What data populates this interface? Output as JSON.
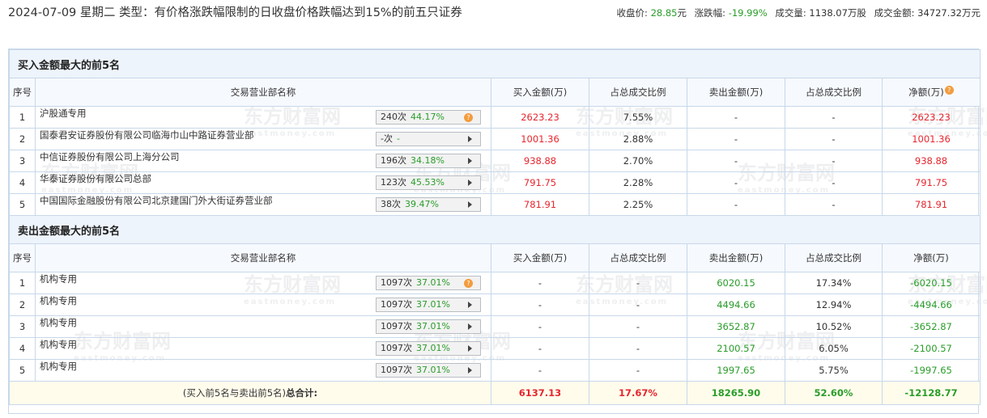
{
  "header": {
    "title": "2024-07-09 星期二 类型：有价格涨跌幅限制的日收盘价格跌幅达到15%的前五只证券",
    "close_label": "收盘价:",
    "close_value": "28.85",
    "close_unit": "元",
    "change_label": "涨跌幅:",
    "change_value": "-19.99%",
    "volume_label": "成交量:",
    "volume_value": "1138.07万股",
    "amount_label": "成交金额:",
    "amount_value": "34727.32万元"
  },
  "columns": {
    "seq": "序号",
    "dept": "交易营业部名称",
    "buy": "买入金额(万)",
    "buy_ratio": "占总成交比例",
    "sell": "卖出金额(万)",
    "sell_ratio": "占总成交比例",
    "net": "净额(万)"
  },
  "buy_section": {
    "title": "买入金额最大的前5名",
    "rows": [
      {
        "seq": "1",
        "name": "沪股通专用",
        "count": "240次",
        "pct": "44.17%",
        "buy": "2623.23",
        "buy_ratio": "7.55%",
        "sell": "-",
        "sell_ratio": "-",
        "net": "2623.23",
        "icon": "question-icon"
      },
      {
        "seq": "2",
        "name": "国泰君安证券股份有限公司临海巾山中路证券营业部",
        "count": "-次",
        "pct": "-",
        "buy": "1001.36",
        "buy_ratio": "2.88%",
        "sell": "-",
        "sell_ratio": "-",
        "net": "1001.36",
        "icon": "arrow-right-icon"
      },
      {
        "seq": "3",
        "name": "中信证券股份有限公司上海分公司",
        "count": "196次",
        "pct": "34.18%",
        "buy": "938.88",
        "buy_ratio": "2.70%",
        "sell": "-",
        "sell_ratio": "-",
        "net": "938.88",
        "icon": "arrow-right-icon"
      },
      {
        "seq": "4",
        "name": "华泰证券股份有限公司总部",
        "count": "123次",
        "pct": "45.53%",
        "buy": "791.75",
        "buy_ratio": "2.28%",
        "sell": "-",
        "sell_ratio": "-",
        "net": "791.75",
        "icon": "arrow-right-icon"
      },
      {
        "seq": "5",
        "name": "中国国际金融股份有限公司北京建国门外大街证券营业部",
        "count": "38次",
        "pct": "39.47%",
        "buy": "781.91",
        "buy_ratio": "2.25%",
        "sell": "-",
        "sell_ratio": "-",
        "net": "781.91",
        "icon": "arrow-right-icon"
      }
    ]
  },
  "sell_section": {
    "title": "卖出金额最大的前5名",
    "rows": [
      {
        "seq": "1",
        "name": "机构专用",
        "count": "1097次",
        "pct": "37.01%",
        "buy": "-",
        "buy_ratio": "-",
        "sell": "6020.15",
        "sell_ratio": "17.34%",
        "net": "-6020.15",
        "icon": "question-icon"
      },
      {
        "seq": "2",
        "name": "机构专用",
        "count": "1097次",
        "pct": "37.01%",
        "buy": "-",
        "buy_ratio": "-",
        "sell": "4494.66",
        "sell_ratio": "12.94%",
        "net": "-4494.66",
        "icon": "arrow-right-icon"
      },
      {
        "seq": "3",
        "name": "机构专用",
        "count": "1097次",
        "pct": "37.01%",
        "buy": "-",
        "buy_ratio": "-",
        "sell": "3652.87",
        "sell_ratio": "10.52%",
        "net": "-3652.87",
        "icon": "arrow-right-icon"
      },
      {
        "seq": "4",
        "name": "机构专用",
        "count": "1097次",
        "pct": "37.01%",
        "buy": "-",
        "buy_ratio": "-",
        "sell": "2100.57",
        "sell_ratio": "6.05%",
        "net": "-2100.57",
        "icon": "arrow-right-icon"
      },
      {
        "seq": "5",
        "name": "机构专用",
        "count": "1097次",
        "pct": "37.01%",
        "buy": "-",
        "buy_ratio": "-",
        "sell": "1997.65",
        "sell_ratio": "5.75%",
        "net": "-1997.65",
        "icon": "arrow-right-icon"
      }
    ]
  },
  "total": {
    "label_prefix": "(买入前5名与卖出前5名)",
    "label_bold": "总合计:",
    "buy": "6137.13",
    "buy_ratio": "17.67%",
    "sell": "18265.90",
    "sell_ratio": "52.60%",
    "net": "-12128.77"
  },
  "watermark": {
    "cn": "东方财富网",
    "en": "eastmoney.com"
  },
  "colors": {
    "up": "#e6262e",
    "down": "#2a9d2a",
    "header_bg": "#eef4fb",
    "total_bg": "#fffcec"
  }
}
